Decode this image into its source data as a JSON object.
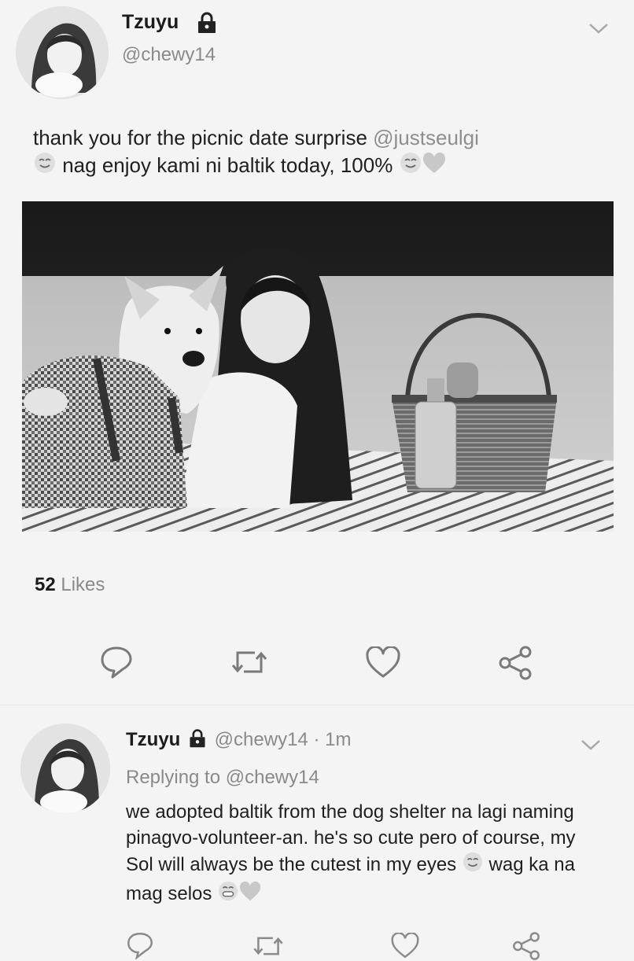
{
  "tweet": {
    "author": "Tzuyu",
    "handle": "@chewy14",
    "text_part1": "thank you for the picnic date surprise ",
    "mention": "@justseulgi",
    "text_part2": " nag enjoy kami ni baltik today, 100% ",
    "likes_count": "52",
    "likes_label": "Likes"
  },
  "reply": {
    "author": "Tzuyu",
    "handle": "@chewy14",
    "dot": "·",
    "time": "1m",
    "replying_label": "Replying to",
    "replying_handle": "@chewy14",
    "text_part1": "we adopted baltik from the dog shelter na lagi naming pinagvo-volunteer-an. he's so cute pero of course, my Sol will always be the cutest in my eyes ",
    "text_part2": " wag ka na mag selos "
  },
  "icons": {
    "lock": "lock-icon",
    "chevron": "chevron-down-icon",
    "reply": "reply-icon",
    "retweet": "retweet-icon",
    "like": "heart-icon",
    "share": "share-icon"
  }
}
